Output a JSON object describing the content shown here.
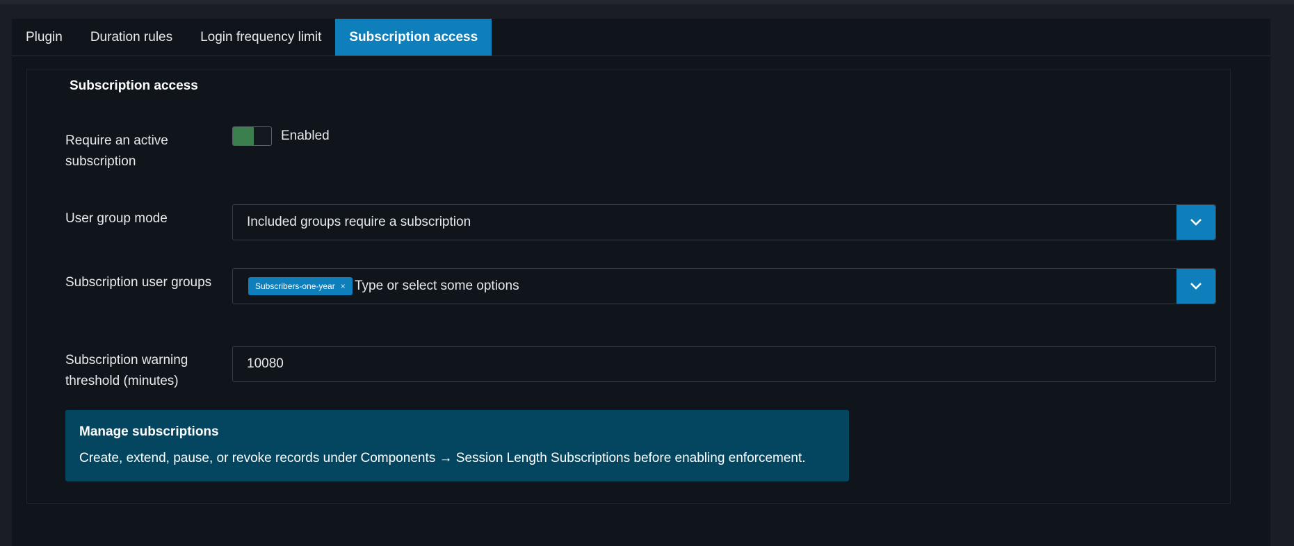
{
  "tabs": [
    {
      "label": "Plugin",
      "active": false
    },
    {
      "label": "Duration rules",
      "active": false
    },
    {
      "label": "Login frequency limit",
      "active": false
    },
    {
      "label": "Subscription access",
      "active": true
    }
  ],
  "fieldset": {
    "legend": "Subscription access"
  },
  "fields": {
    "require_active": {
      "label": "Require an active subscription",
      "state": "Enabled",
      "checked": true
    },
    "user_group_mode": {
      "label": "User group mode",
      "value": "Included groups require a subscription"
    },
    "subscription_groups": {
      "label": "Subscription user groups",
      "chips": [
        "Subscribers-one-year"
      ],
      "chip_remove": "×",
      "placeholder": "Type or select some options"
    },
    "warning_threshold": {
      "label": "Subscription warning threshold (minutes)",
      "value": "10080"
    }
  },
  "alert": {
    "title": "Manage subscriptions",
    "body": "Create, extend, pause, or revoke records under Components → Session Length Subscriptions before enabling enforcement."
  },
  "colors": {
    "accent": "#0f7fbb",
    "toggle_on": "#3b7f4e",
    "alert_bg": "#044560",
    "card_bg": "#10151c",
    "page_bg": "#1a1d24"
  },
  "icons": {
    "dropdown": "chevron-down-icon",
    "remove_chip": "close-icon"
  }
}
